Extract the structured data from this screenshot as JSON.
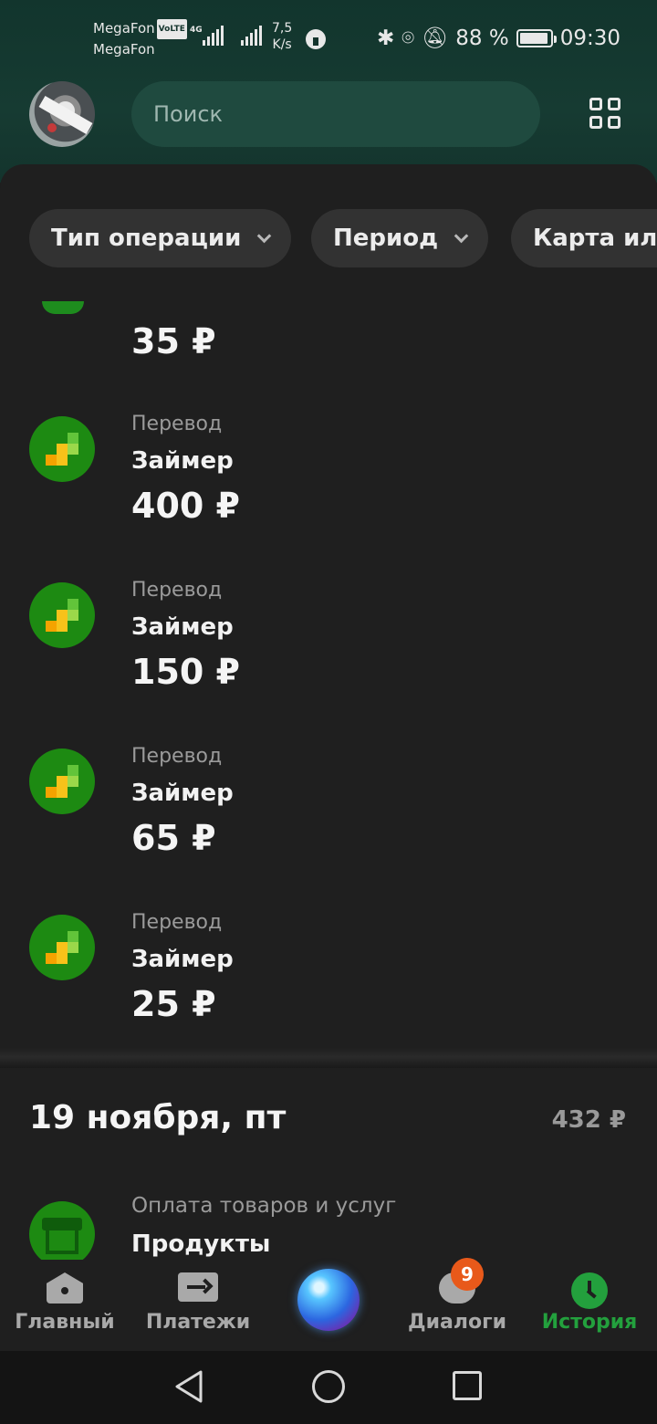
{
  "status_bar": {
    "carrier1": "MegaFon",
    "volte": "VoLTE",
    "carrier2": "MegaFon",
    "network": "4G",
    "speed_value": "7,5",
    "speed_unit": "K/s",
    "battery_percent": "88 %",
    "time": "09:30"
  },
  "header": {
    "search_placeholder": "Поиск"
  },
  "filters": [
    {
      "label": "Тип операции"
    },
    {
      "label": "Период"
    },
    {
      "label": "Карта или"
    }
  ],
  "transactions": [
    {
      "amount": "35 ₽"
    },
    {
      "type": "Перевод",
      "name": "Займер",
      "amount": "400 ₽"
    },
    {
      "type": "Перевод",
      "name": "Займер",
      "amount": "150 ₽"
    },
    {
      "type": "Перевод",
      "name": "Займер",
      "amount": "65 ₽"
    },
    {
      "type": "Перевод",
      "name": "Займер",
      "amount": "25 ₽"
    }
  ],
  "day_group": {
    "date": "19 ноября, пт",
    "total": "432 ₽",
    "first_item": {
      "type": "Оплата товаров и услуг",
      "name": "Продукты"
    }
  },
  "bottom_nav": {
    "items": [
      {
        "label": "Главный",
        "icon": "home-icon"
      },
      {
        "label": "Платежи",
        "icon": "payments-icon"
      },
      {
        "label": "",
        "icon": "assistant-orb-icon"
      },
      {
        "label": "Диалоги",
        "icon": "chat-icon",
        "badge": "9"
      },
      {
        "label": "История",
        "icon": "clock-icon",
        "active": true
      }
    ],
    "active_color": "#23a03d",
    "inactive_color": "#a9a9a9"
  },
  "colors": {
    "accent_green": "#1d8a12",
    "badge_orange": "#e8591a",
    "background": "#1f1f1f"
  }
}
